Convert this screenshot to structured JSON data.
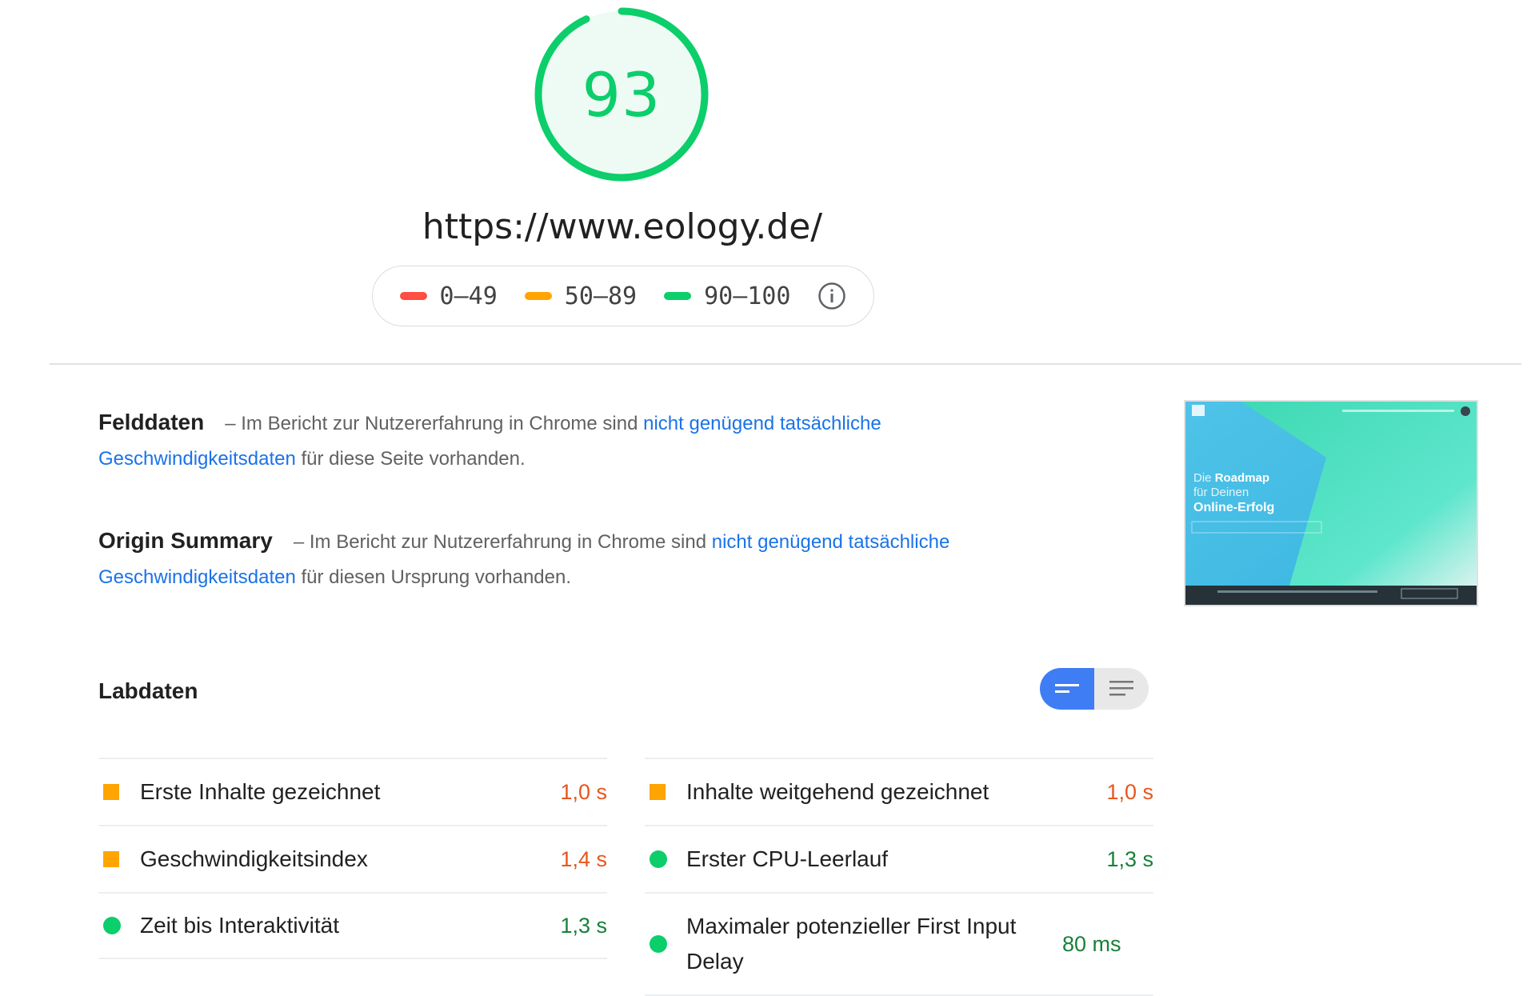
{
  "score": {
    "value": "93",
    "fraction": 0.93,
    "color": "#0cce6b"
  },
  "url": "https://www.eology.de/",
  "legend": [
    {
      "range": "0–49",
      "color": "#ff4e42"
    },
    {
      "range": "50–89",
      "color": "#ffa400"
    },
    {
      "range": "90–100",
      "color": "#0cce6b"
    }
  ],
  "field_data": {
    "title": "Felddaten",
    "text_before": "– Im Bericht zur Nutzererfahrung in Chrome sind ",
    "link": "nicht genügend tatsächliche Geschwindigkeitsdaten",
    "text_after": " für diese Seite vorhanden."
  },
  "origin_summary": {
    "title": "Origin Summary",
    "text_before": "– Im Bericht zur Nutzererfahrung in Chrome sind ",
    "link": "nicht genügend tatsächliche Geschwindigkeitsdaten",
    "text_after": " für diesen Ursprung vorhanden."
  },
  "thumbnail": {
    "line1_light": "Die ",
    "line1_bold": "Roadmap",
    "line2": "für Deinen",
    "line3": "Online-Erfolg"
  },
  "lab_data": {
    "title": "Labdaten",
    "left": [
      {
        "label": "Erste Inhalte gezeichnet",
        "value": "1,0 s",
        "status": "average"
      },
      {
        "label": "Geschwindigkeitsindex",
        "value": "1,4 s",
        "status": "average"
      },
      {
        "label": "Zeit bis Interaktivität",
        "value": "1,3 s",
        "status": "pass"
      }
    ],
    "right": [
      {
        "label": "Inhalte weitgehend gezeichnet",
        "value": "1,0 s",
        "status": "average"
      },
      {
        "label": "Erster CPU-Leerlauf",
        "value": "1,3 s",
        "status": "pass"
      },
      {
        "label": "Maximaler potenzieller First Input Delay",
        "value": "80 ms",
        "status": "pass"
      }
    ]
  },
  "colors": {
    "average": "#ffa400",
    "average_text": "#e8561c",
    "pass": "#0cce6b",
    "pass_text": "#188038",
    "link": "#1a73e8",
    "toggle_active": "#3f7df5"
  }
}
